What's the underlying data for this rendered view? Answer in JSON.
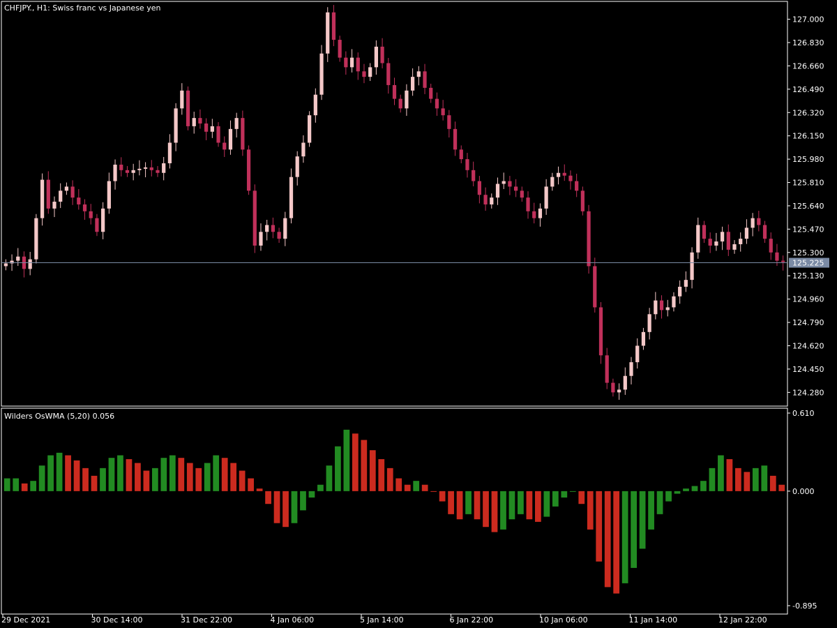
{
  "chart_data": [
    {
      "type": "candlestick",
      "title": "CHFJPY., H1:  Swiss franc vs Japanese yen",
      "current_price": "125.225",
      "current_price_value": 125.225,
      "ylim": [
        124.18,
        127.13
      ],
      "y_ticks": [
        "127.000",
        "126.830",
        "126.660",
        "126.490",
        "126.320",
        "126.150",
        "125.980",
        "125.810",
        "125.640",
        "125.470",
        "125.300",
        "125.130",
        "124.960",
        "124.790",
        "124.620",
        "124.450",
        "124.280"
      ],
      "x_ticks": [
        "29 Dec 2021",
        "30 Dec 14:00",
        "31 Dec 22:00",
        "4 Jan 06:00",
        "5 Jan 14:00",
        "6 Jan 22:00",
        "10 Jan 06:00",
        "11 Jan 14:00",
        "12 Jan 22:00"
      ],
      "closes": [
        125.22,
        125.24,
        125.27,
        125.18,
        125.25,
        125.55,
        125.83,
        125.62,
        125.67,
        125.75,
        125.78,
        125.7,
        125.65,
        125.6,
        125.55,
        125.45,
        125.62,
        125.82,
        125.94,
        125.9,
        125.88,
        125.9,
        125.91,
        125.92,
        125.9,
        125.88,
        125.95,
        126.1,
        126.35,
        126.48,
        126.22,
        126.28,
        126.24,
        126.18,
        126.22,
        126.1,
        126.05,
        126.2,
        126.28,
        126.05,
        125.75,
        125.35,
        125.45,
        125.5,
        125.45,
        125.4,
        125.55,
        125.85,
        126.0,
        126.1,
        126.3,
        126.45,
        126.75,
        127.05,
        126.85,
        126.72,
        126.65,
        126.72,
        126.62,
        126.58,
        126.65,
        126.8,
        126.68,
        126.52,
        126.42,
        126.35,
        126.48,
        126.58,
        126.62,
        126.5,
        126.42,
        126.35,
        126.3,
        126.2,
        126.05,
        125.98,
        125.9,
        125.82,
        125.72,
        125.65,
        125.7,
        125.8,
        125.82,
        125.78,
        125.75,
        125.7,
        125.6,
        125.55,
        125.62,
        125.78,
        125.85,
        125.88,
        125.86,
        125.82,
        125.75,
        125.6,
        125.2,
        124.9,
        124.55,
        124.35,
        124.28,
        124.3,
        124.4,
        124.5,
        124.62,
        124.72,
        124.85,
        124.95,
        124.88,
        124.9,
        124.98,
        125.05,
        125.1,
        125.3,
        125.5,
        125.4,
        125.35,
        125.38,
        125.45,
        125.32,
        125.36,
        125.4,
        125.48,
        125.55,
        125.5,
        125.4,
        125.3,
        125.24,
        125.23
      ],
      "histogram": {
        "title": "Wilders OsWMA (5,20) 0.056",
        "ylim": [
          -0.895,
          0.61
        ],
        "y_ticks": [
          "0.610",
          "0.000",
          "-0.895"
        ],
        "values": [
          0.1,
          0.1,
          0.06,
          0.08,
          0.2,
          0.28,
          0.3,
          0.28,
          0.24,
          0.18,
          0.12,
          0.18,
          0.26,
          0.28,
          0.25,
          0.22,
          0.16,
          0.18,
          0.26,
          0.28,
          0.26,
          0.22,
          0.18,
          0.22,
          0.28,
          0.26,
          0.22,
          0.16,
          0.1,
          0.02,
          -0.1,
          -0.25,
          -0.28,
          -0.25,
          -0.15,
          -0.05,
          0.05,
          0.2,
          0.35,
          0.48,
          0.45,
          0.4,
          0.32,
          0.25,
          0.18,
          0.1,
          0.05,
          0.08,
          0.05,
          0.0,
          -0.08,
          -0.18,
          -0.22,
          -0.18,
          -0.22,
          -0.28,
          -0.32,
          -0.3,
          -0.22,
          -0.18,
          -0.22,
          -0.24,
          -0.2,
          -0.12,
          -0.05,
          0.0,
          -0.1,
          -0.3,
          -0.55,
          -0.75,
          -0.8,
          -0.72,
          -0.6,
          -0.45,
          -0.3,
          -0.18,
          -0.08,
          -0.02,
          0.02,
          0.04,
          0.08,
          0.18,
          0.28,
          0.25,
          0.18,
          0.15,
          0.18,
          0.2,
          0.12,
          0.05
        ],
        "up_color": "#228B22",
        "down_color": "#CC2B1F"
      }
    }
  ],
  "colors": {
    "background": "#000000",
    "grid_border": "#FFFFFF",
    "bull_candle": "#F4C8C8",
    "bear_candle": "#C0305A",
    "price_line": "#7B8BA5",
    "price_label_bg": "#7B8BA5"
  }
}
